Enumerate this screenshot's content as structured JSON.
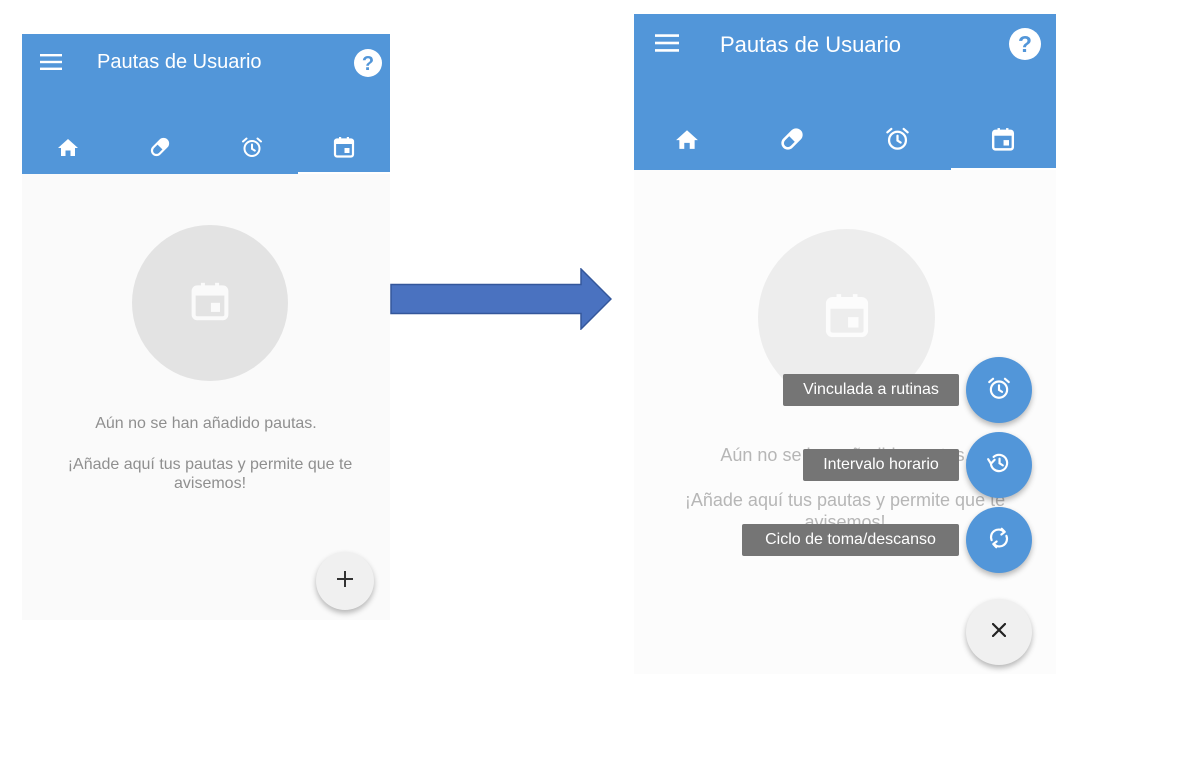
{
  "screen_before": {
    "appbar": {
      "title": "Pautas de Usuario"
    },
    "tabs": [
      {
        "icon": "home-icon"
      },
      {
        "icon": "pill-icon"
      },
      {
        "icon": "alarm-icon"
      },
      {
        "icon": "calendar-icon",
        "active": true
      }
    ],
    "empty_state": {
      "icon": "calendar-icon",
      "message": "Aún no se han añadido pautas.",
      "hint": "¡Añade aquí tus pautas y permite que te avisemos!"
    },
    "fab": {
      "icon": "plus-icon",
      "label": "+"
    }
  },
  "screen_after": {
    "appbar": {
      "title": "Pautas de Usuario"
    },
    "tabs": [
      {
        "icon": "home-icon"
      },
      {
        "icon": "pill-icon"
      },
      {
        "icon": "alarm-icon"
      },
      {
        "icon": "calendar-icon",
        "active": true
      }
    ],
    "empty_state": {
      "icon": "calendar-icon",
      "message": "Aún no se han añadido pautas.",
      "hint": "¡Añade aquí tus pautas y permite que te avisemos!"
    },
    "speed_dial": [
      {
        "label": "Vinculada a rutinas",
        "icon": "alarm-icon"
      },
      {
        "label": "Intervalo horario",
        "icon": "history-icon"
      },
      {
        "label": "Ciclo de toma/descanso",
        "icon": "sync-icon"
      }
    ],
    "close_fab": {
      "icon": "close-icon",
      "label": "✕"
    }
  },
  "colors": {
    "primary": "#5296d9",
    "background": "#fafafa",
    "chip": "#757575",
    "arrow": "#4a72c0"
  }
}
